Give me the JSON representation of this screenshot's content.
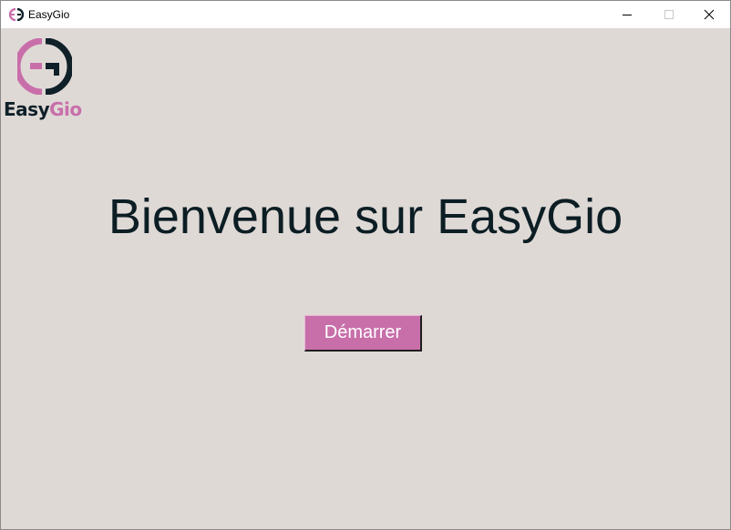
{
  "window": {
    "title": "EasyGio",
    "controls": {
      "minimize_icon": "minimize-icon",
      "maximize_icon": "maximize-icon",
      "close_icon": "close-icon"
    }
  },
  "logo": {
    "monogram": "EG",
    "word_part1": "Easy",
    "word_part2": "Gio"
  },
  "main": {
    "heading": "Bienvenue sur EasyGio",
    "start_button_label": "Démarrer"
  },
  "colors": {
    "background": "#dfd9d6",
    "accent": "#c86faa",
    "text_dark": "#0c1e24",
    "titlebar": "#ffffff"
  }
}
